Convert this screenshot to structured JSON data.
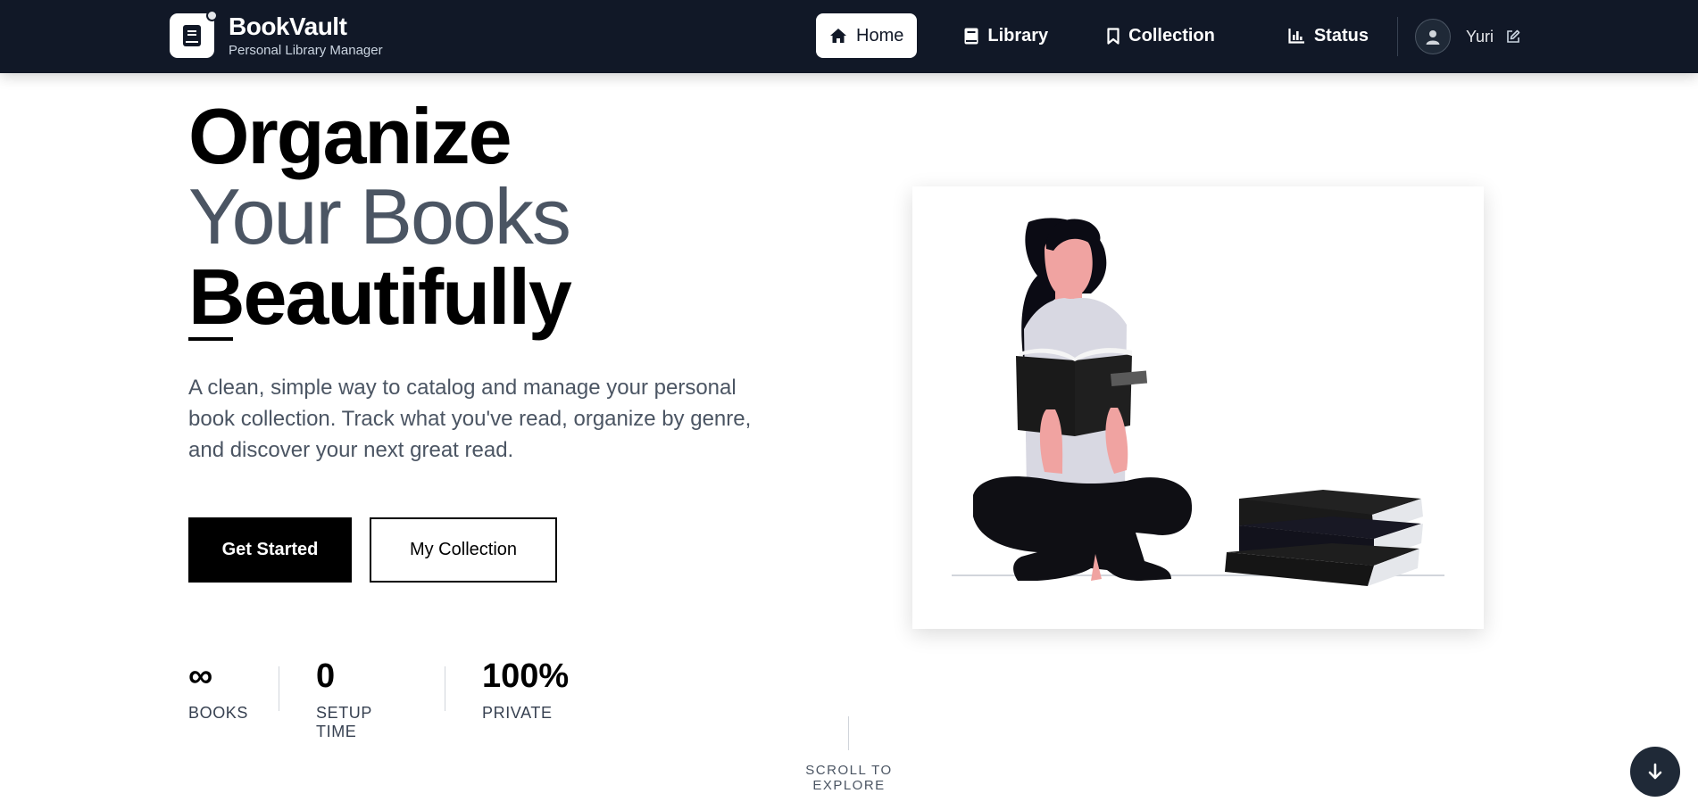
{
  "brand": {
    "name": "BookVault",
    "subtitle": "Personal Library Manager",
    "logo_icon": "book-icon"
  },
  "nav": {
    "items": [
      {
        "label": "Home",
        "icon": "home-icon",
        "active": true
      },
      {
        "label": "Library",
        "icon": "book-icon",
        "active": false
      },
      {
        "label": "Collection",
        "icon": "bookmark-icon",
        "active": false
      },
      {
        "label": "Status",
        "icon": "bar-chart-icon",
        "active": false
      }
    ],
    "user": {
      "name": "Yuri",
      "avatar_icon": "user-icon",
      "edit_icon": "edit-icon"
    }
  },
  "hero": {
    "line1": "Organize",
    "line2": "Your Books",
    "line3": "Beautifully",
    "description": "A clean, simple way to catalog and manage your personal book collection. Track what you've read, organize by genre, and discover your next great read.",
    "primary_button": "Get Started",
    "secondary_button": "My Collection"
  },
  "stats": [
    {
      "value": "∞",
      "label": "BOOKS"
    },
    {
      "value": "0",
      "label": "SETUP TIME"
    },
    {
      "value": "100%",
      "label": "PRIVATE"
    }
  ],
  "scroll": {
    "label": "SCROLL TO EXPLORE",
    "icon": "arrow-down-icon"
  },
  "colors": {
    "nav_bg": "#111827",
    "accent": "#000000",
    "muted_text": "#4b5563",
    "skin": "#f0a3a1"
  }
}
